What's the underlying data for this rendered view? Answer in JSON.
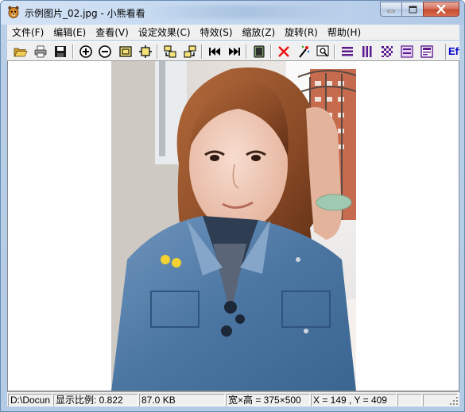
{
  "window": {
    "title": "示例图片_02.jpg - 小熊看看",
    "accent_color": "#c7daf0",
    "controls": {
      "minimize": "minimize-icon",
      "maximize": "maximize-icon",
      "close": "close-icon"
    }
  },
  "menu": [
    {
      "label": "文件(F)"
    },
    {
      "label": "编辑(E)"
    },
    {
      "label": "查看(V)"
    },
    {
      "label": "设定效果(C)"
    },
    {
      "label": "特效(S)"
    },
    {
      "label": "缩放(Z)"
    },
    {
      "label": "旋转(R)"
    },
    {
      "label": "帮助(H)"
    }
  ],
  "toolbar": {
    "icons": [
      "open-folder-icon",
      "print-icon",
      "save-icon",
      "zoom-in-icon",
      "zoom-out-icon",
      "fit-window-icon",
      "actual-size-icon",
      "rotate-left-icon",
      "rotate-right-icon",
      "first-image-icon",
      "last-image-icon",
      "slideshow-icon",
      "delete-icon",
      "effects-wand-icon",
      "crop-icon",
      "horizontal-lines-icon",
      "vertical-bars-icon",
      "mosaic-icon",
      "filter-icon",
      "frame-icon"
    ],
    "effect_label": "Eff"
  },
  "image": {
    "description_icon": "photo-image",
    "alt": "示例图片_02.jpg"
  },
  "status": {
    "path": "D:\\Docun",
    "scale": "显示比例: 0.822",
    "size": "87.0 KB",
    "dimensions": "宽×高 = 375×500",
    "coords": "X = 149 , Y = 409"
  }
}
